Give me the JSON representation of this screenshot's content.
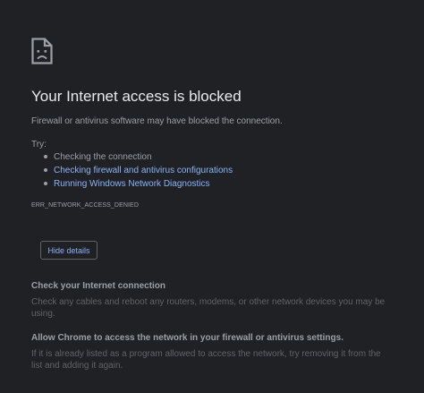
{
  "error": {
    "icon": "sad-page-icon",
    "title": "Your Internet access is blocked",
    "subtitle": "Firewall or antivirus software may have blocked the connection.",
    "try_label": "Try:",
    "suggestions": [
      {
        "text": "Checking the connection",
        "is_link": false
      },
      {
        "text": "Checking firewall and antivirus configurations",
        "is_link": true
      },
      {
        "text": "Running Windows Network Diagnostics",
        "is_link": true
      }
    ],
    "code": "ERR_NETWORK_ACCESS_DENIED",
    "details_button": "Hide details"
  },
  "details": [
    {
      "heading": "Check your Internet connection",
      "body": "Check any cables and reboot any routers, modems, or other network devices you may be using."
    },
    {
      "heading": "Allow Chrome to access the network in your firewall or antivirus settings.",
      "body": "If it is already listed as a program allowed to access the network, try removing it from the list and adding it again."
    }
  ],
  "colors": {
    "background": "#202124",
    "title": "#e8eaed",
    "text": "#9aa0a6",
    "link": "#8ab4f8",
    "muted": "#5f6368"
  }
}
